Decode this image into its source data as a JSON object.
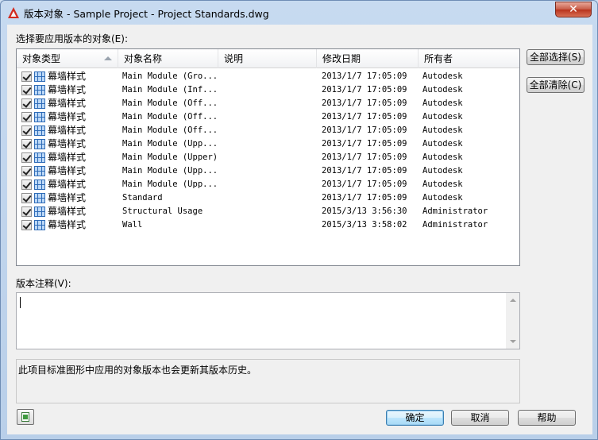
{
  "window": {
    "title": "版本对象 - Sample Project - Project Standards.dwg",
    "close_label": "✕"
  },
  "labels": {
    "objects_prompt": "选择要应用版本的对象(E):",
    "notes_label": "版本注释(V):",
    "info_text": "此项目标准图形中应用的对象版本也会更新其版本历史。"
  },
  "columns": [
    "对象类型",
    "对象名称",
    "说明",
    "修改日期",
    "所有者"
  ],
  "rows": [
    {
      "type": "幕墙样式",
      "name": "Main Module (Gro...",
      "desc": "",
      "date": "2013/1/7 17:05:09",
      "owner": "Autodesk"
    },
    {
      "type": "幕墙样式",
      "name": "Main Module (Inf...",
      "desc": "",
      "date": "2013/1/7 17:05:09",
      "owner": "Autodesk"
    },
    {
      "type": "幕墙样式",
      "name": "Main Module (Off...",
      "desc": "",
      "date": "2013/1/7 17:05:09",
      "owner": "Autodesk"
    },
    {
      "type": "幕墙样式",
      "name": "Main Module (Off...",
      "desc": "",
      "date": "2013/1/7 17:05:09",
      "owner": "Autodesk"
    },
    {
      "type": "幕墙样式",
      "name": "Main Module (Off...",
      "desc": "",
      "date": "2013/1/7 17:05:09",
      "owner": "Autodesk"
    },
    {
      "type": "幕墙样式",
      "name": "Main Module (Upp...",
      "desc": "",
      "date": "2013/1/7 17:05:09",
      "owner": "Autodesk"
    },
    {
      "type": "幕墙样式",
      "name": "Main Module (Upper)",
      "desc": "",
      "date": "2013/1/7 17:05:09",
      "owner": "Autodesk"
    },
    {
      "type": "幕墙样式",
      "name": "Main Module (Upp...",
      "desc": "",
      "date": "2013/1/7 17:05:09",
      "owner": "Autodesk"
    },
    {
      "type": "幕墙样式",
      "name": "Main Module (Upp...",
      "desc": "",
      "date": "2013/1/7 17:05:09",
      "owner": "Autodesk"
    },
    {
      "type": "幕墙样式",
      "name": "Standard",
      "desc": "",
      "date": "2013/1/7 17:05:09",
      "owner": "Autodesk"
    },
    {
      "type": "幕墙样式",
      "name": "Structural Usage",
      "desc": "",
      "date": "2015/3/13 3:56:30",
      "owner": "Administrator"
    },
    {
      "type": "幕墙样式",
      "name": "Wall",
      "desc": "",
      "date": "2015/3/13 3:58:02",
      "owner": "Administrator"
    }
  ],
  "buttons": {
    "select_all": "全部选择(S)",
    "clear_all": "全部清除(C)",
    "ok": "确定",
    "cancel": "取消",
    "help": "帮助"
  },
  "notes": {
    "value": ""
  },
  "icons": {
    "app": "autocad-logo-icon",
    "row_type": "curtain-wall-grid-icon",
    "history": "version-history-icon"
  }
}
